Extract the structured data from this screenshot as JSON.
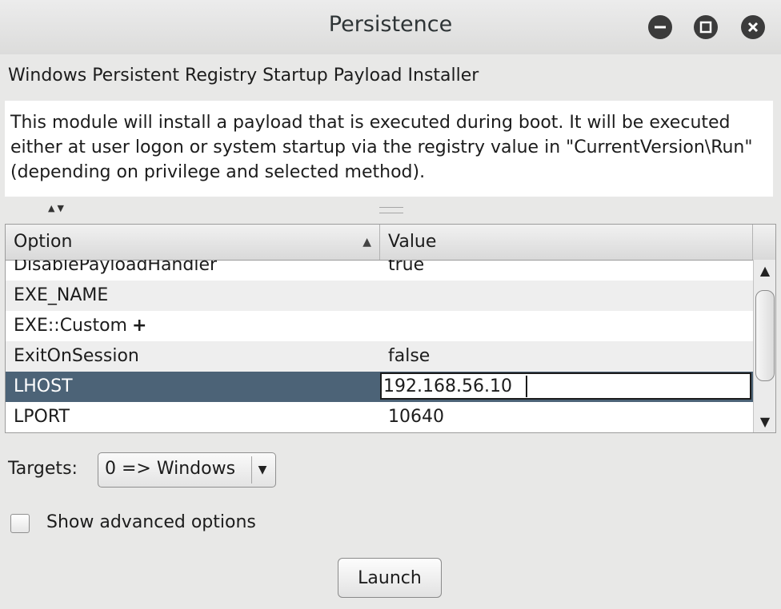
{
  "window": {
    "title": "Persistence"
  },
  "module": {
    "name": "Windows Persistent Registry Startup Payload Installer",
    "description": "This module will install a payload that is executed during boot. It will be executed either at user logon or system startup via the registry value in \"CurrentVersion\\Run\" (depending on privilege and selected method)."
  },
  "table": {
    "columns": {
      "option": "Option",
      "value": "Value"
    },
    "rows": [
      {
        "option": "DisablePayloadHandler",
        "value": "true"
      },
      {
        "option": "EXE_NAME",
        "value": ""
      },
      {
        "option": "EXE::Custom",
        "value": ""
      },
      {
        "option": "ExitOnSession",
        "value": "false"
      },
      {
        "option": "LHOST",
        "value": "192.168.56.10"
      },
      {
        "option": "LPORT",
        "value": "10640"
      }
    ],
    "selected_row": "LHOST"
  },
  "targets": {
    "label": "Targets:",
    "selected": "0 => Windows"
  },
  "advanced": {
    "label": "Show advanced options",
    "checked": false
  },
  "launch": {
    "label": "Launch"
  },
  "colors": {
    "selection": "#4c6377",
    "window_bg": "#e8e8e7"
  }
}
